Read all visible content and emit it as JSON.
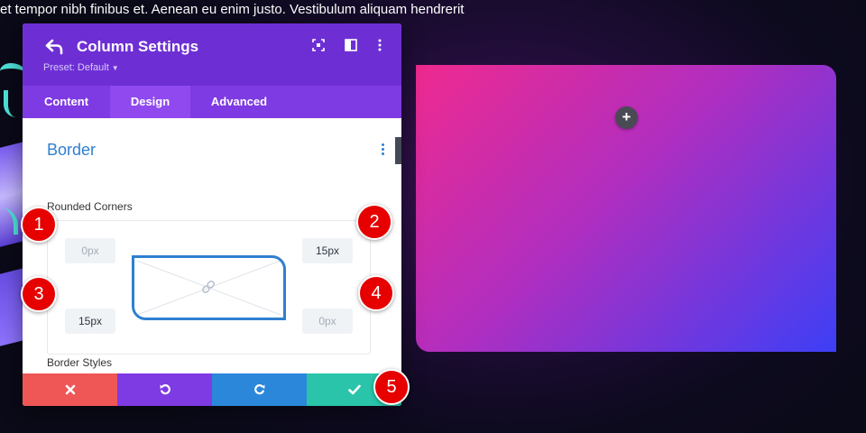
{
  "page": {
    "background_text": "et tempor nibh finibus et. Aenean eu enim justo. Vestibulum aliquam hendrerit"
  },
  "colors": {
    "header": "#6d2fd4",
    "tabs": "#7e3ae3",
    "tab_active": "#9049ee",
    "accent_blue": "#2f7fd1",
    "cancel": "#ef5656",
    "undo": "#7e3ae3",
    "redo": "#2b87da",
    "save": "#29c4a9",
    "marker": "#e60000"
  },
  "modal": {
    "title": "Column Settings",
    "preset": "Preset: Default",
    "header_icons": [
      "back-icon",
      "fullscreen-icon",
      "split-view-icon",
      "more-vertical-icon"
    ],
    "tabs": [
      {
        "label": "Content",
        "active": false
      },
      {
        "label": "Design",
        "active": true
      },
      {
        "label": "Advanced",
        "active": false
      }
    ],
    "section": {
      "title": "Border",
      "rounded_corners_label": "Rounded Corners",
      "corners": {
        "top_left": {
          "value": "",
          "placeholder": "0px"
        },
        "top_right": {
          "value": "15px",
          "placeholder": "0px"
        },
        "bottom_left": {
          "value": "15px",
          "placeholder": "0px"
        },
        "bottom_right": {
          "value": "",
          "placeholder": "0px"
        }
      },
      "border_styles_label": "Border Styles"
    },
    "footer_buttons": [
      "close-icon",
      "undo-icon",
      "redo-icon",
      "check-icon"
    ]
  },
  "markers": [
    "1",
    "2",
    "3",
    "4",
    "5"
  ],
  "card": {
    "add_icon": "plus-icon",
    "add_glyph": "+"
  }
}
